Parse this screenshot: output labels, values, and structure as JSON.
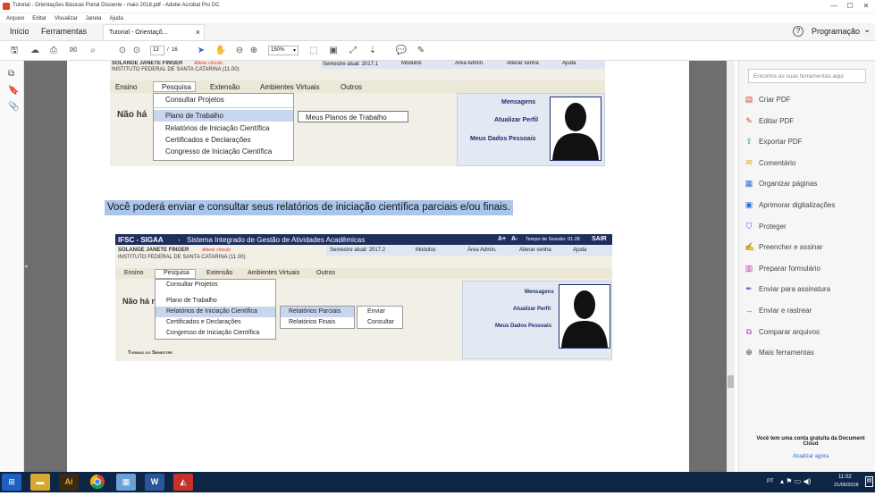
{
  "window": {
    "title": "Tutorial - Orientações Básicas Portal Discente - maio 2018.pdf - Adobe Acrobat Pro DC",
    "min": "—",
    "max": "☐",
    "close": "✕"
  },
  "menu": [
    "Arquivo",
    "Editar",
    "Visualizar",
    "Janela",
    "Ajuda"
  ],
  "tabs": {
    "home": "Início",
    "tools": "Ferramentas",
    "doc": "Tutorial - Orientaçõ...",
    "doc_close": "×",
    "help": "?",
    "signin": "Programação",
    "signin_arrow": "⌄"
  },
  "toolbar": {
    "page_current": "13",
    "page_sep": "/",
    "page_total": "16",
    "zoom": "150%",
    "zoom_arrow": "▾"
  },
  "doc": {
    "top": {
      "user": "SOLANGE JANETE FINGER",
      "user_link": "Alterar vínculo",
      "inst": "INSTITUTO FEDERAL DE SANTA CATARINA (11.00)",
      "semester": "Semestre atual: 2017.1",
      "modulos": "Módulos",
      "area": "Área Admin.",
      "senha": "Alterar senha",
      "ajuda": "Ajuda",
      "nav": [
        "Ensino",
        "Pesquisa",
        "Extensão",
        "Ambientes Virtuais",
        "Outros"
      ],
      "dropdown": [
        "Consultar Projetos",
        "Plano de Trabalho",
        "Relatórios de Iniciação Científica",
        "Certificados e Declarações",
        "Congresso de Iniciação Científica"
      ],
      "submenu": "Meus Planos de Trabalho",
      "nao_ha": "Não há",
      "profile": [
        "Mensagens",
        "Atualizar Perfil",
        "Meus Dados Pessoais"
      ]
    },
    "caption": "Você poderá enviar e consultar seus relatórios de iniciação científica parciais e/ou finais.",
    "bottom": {
      "header_left": "IFSC - SIGAA",
      "header_sep": "-",
      "header_sub": "Sistema Integrado de Gestão de Atividades Acadêmicas",
      "font_big": "A+",
      "font_small": "A-",
      "session": "Tempo de Sessão: 01:28",
      "sair": "SAIR",
      "user": "SOLANGE JANETE FINGER",
      "user_link": "Alterar vínculo",
      "inst": "INSTITUTO FEDERAL DE SANTA CATARINA (11.00)",
      "semester": "Semestre atual: 2017.2",
      "modulos": "Módulos",
      "area": "Área Admin.",
      "senha": "Alterar senha",
      "ajuda": "Ajuda",
      "nav": [
        "Ensino",
        "Pesquisa",
        "Extensão",
        "Ambientes Virtuais",
        "Outros"
      ],
      "dropdown": [
        "Consultar Projetos",
        "Plano de Trabalho",
        "Relatórios de Iniciação Científica",
        "Certificados e Declarações",
        "Congresso de Iniciação Científica"
      ],
      "sub1": [
        "Relatórios Parciais",
        "Relatórios Finais"
      ],
      "sub2": [
        "Enviar",
        "Consultar"
      ],
      "nao_ha": "Não há n",
      "turmas": "Turmas do Semestre",
      "profile": [
        "Mensagens",
        "Atualizar Perfil",
        "Meus Dados Pessoais"
      ]
    }
  },
  "right": {
    "search": "Encontre as suas ferramentas aqui",
    "tools": [
      {
        "label": "Criar PDF",
        "color": "#d9442e",
        "icon": "▤"
      },
      {
        "label": "Editar PDF",
        "color": "#d9442e",
        "icon": "✎"
      },
      {
        "label": "Exportar PDF",
        "color": "#2e9b54",
        "icon": "⇪"
      },
      {
        "label": "Comentário",
        "color": "#e5a21a",
        "icon": "✉"
      },
      {
        "label": "Organizar páginas",
        "color": "#2a6ad1",
        "icon": "▦"
      },
      {
        "label": "Aprimorar digitalizações",
        "color": "#2a6ad1",
        "icon": "▣"
      },
      {
        "label": "Proteger",
        "color": "#2a6ad1",
        "icon": "⛉"
      },
      {
        "label": "Preencher e assinar",
        "color": "#c13aa6",
        "icon": "✍"
      },
      {
        "label": "Preparar formulário",
        "color": "#c13aa6",
        "icon": "▥"
      },
      {
        "label": "Enviar para assinatura",
        "color": "#7c3fc4",
        "icon": "✒"
      },
      {
        "label": "Enviar e rastrear",
        "color": "#2a6ad1",
        "icon": "→"
      },
      {
        "label": "Comparar arquivos",
        "color": "#c13aa6",
        "icon": "⧉"
      },
      {
        "label": "Mais ferramentas",
        "color": "#444444",
        "icon": "⊕"
      }
    ],
    "cloud": "Você tem uma conta gratuita da Document Cloud",
    "upgrade": "Atualizar agora"
  },
  "taskbar": {
    "lang": "PT",
    "time": "11:02",
    "date": "21/06/2018"
  }
}
